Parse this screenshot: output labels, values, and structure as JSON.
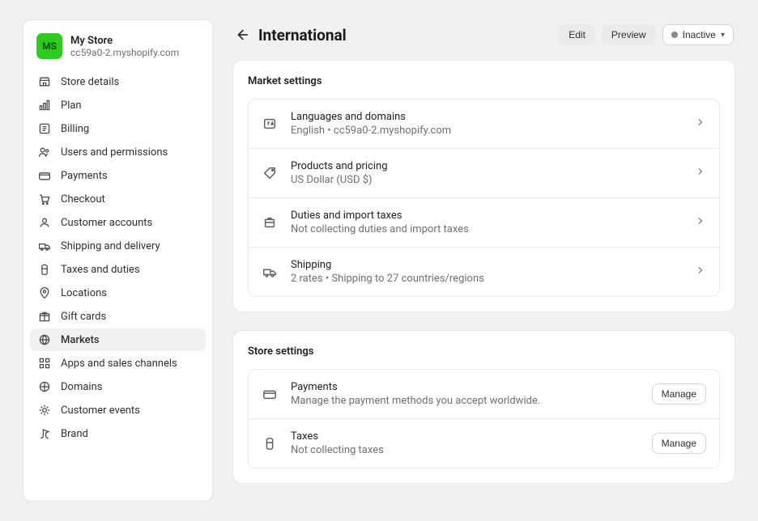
{
  "store": {
    "avatar_initials": "MS",
    "name": "My Store",
    "domain": "cc59a0-2.myshopify.com"
  },
  "sidebar": {
    "items": [
      {
        "label": "Store details",
        "icon": "storefront-icon",
        "active": false
      },
      {
        "label": "Plan",
        "icon": "plan-icon",
        "active": false
      },
      {
        "label": "Billing",
        "icon": "billing-icon",
        "active": false
      },
      {
        "label": "Users and permissions",
        "icon": "users-icon",
        "active": false
      },
      {
        "label": "Payments",
        "icon": "payments-icon",
        "active": false
      },
      {
        "label": "Checkout",
        "icon": "checkout-icon",
        "active": false
      },
      {
        "label": "Customer accounts",
        "icon": "customer-icon",
        "active": false
      },
      {
        "label": "Shipping and delivery",
        "icon": "shipping-icon",
        "active": false
      },
      {
        "label": "Taxes and duties",
        "icon": "taxes-icon",
        "active": false
      },
      {
        "label": "Locations",
        "icon": "location-icon",
        "active": false
      },
      {
        "label": "Gift cards",
        "icon": "giftcard-icon",
        "active": false
      },
      {
        "label": "Markets",
        "icon": "markets-icon",
        "active": true
      },
      {
        "label": "Apps and sales channels",
        "icon": "apps-icon",
        "active": false
      },
      {
        "label": "Domains",
        "icon": "domains-icon",
        "active": false
      },
      {
        "label": "Customer events",
        "icon": "events-icon",
        "active": false
      },
      {
        "label": "Brand",
        "icon": "brand-icon",
        "active": false
      }
    ]
  },
  "header": {
    "title": "International",
    "edit_label": "Edit",
    "preview_label": "Preview",
    "status_label": "Inactive"
  },
  "market_settings": {
    "title": "Market settings",
    "rows": [
      {
        "icon": "language-icon",
        "title": "Languages and domains",
        "sub": "English • cc59a0-2.myshopify.com"
      },
      {
        "icon": "tag-icon",
        "title": "Products and pricing",
        "sub": "US Dollar (USD $)"
      },
      {
        "icon": "duties-icon",
        "title": "Duties and import taxes",
        "sub": "Not collecting duties and import taxes"
      },
      {
        "icon": "truck-icon",
        "title": "Shipping",
        "sub": "2 rates • Shipping to 27 countries/regions"
      }
    ]
  },
  "store_settings": {
    "title": "Store settings",
    "rows": [
      {
        "icon": "payments-icon",
        "title": "Payments",
        "sub": "Manage the payment methods you accept worldwide.",
        "action": "Manage"
      },
      {
        "icon": "taxes-icon",
        "title": "Taxes",
        "sub": "Not collecting taxes",
        "action": "Manage"
      }
    ]
  }
}
